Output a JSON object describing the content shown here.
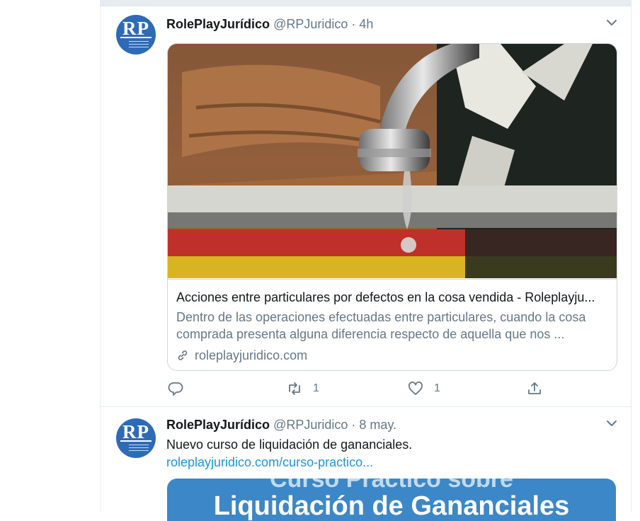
{
  "tweets": [
    {
      "avatar_text": "RP",
      "author_name": "RolePlayJurídico",
      "author_handle": "@RPJuridico",
      "separator": "·",
      "time": "4h",
      "card": {
        "title": "Acciones entre particulares por defectos en la cosa vendida - Roleplayju...",
        "description": "Dentro de las operaciones efectuadas entre particulares, cuando la cosa comprada presenta alguna diferencia respecto de aquella que nos ...",
        "domain": "roleplayjuridico.com"
      },
      "actions": {
        "reply_count": "",
        "retweet_count": "1",
        "like_count": "1"
      }
    },
    {
      "avatar_text": "RP",
      "author_name": "RolePlayJurídico",
      "author_handle": "@RPJuridico",
      "separator": "·",
      "time": "8 may.",
      "text": "Nuevo curso de liquidación de gananciales.",
      "link": "roleplayjuridico.com/curso-practico...",
      "media_text_line1": "Curso Práctico sobre",
      "media_text_line2": "Liquidación de Gananciales"
    }
  ],
  "colors": {
    "brand_blue": "#1b95e0",
    "avatar_blue": "#2e6bb6",
    "secondary_text": "#657786",
    "border": "#e6ecf0"
  }
}
